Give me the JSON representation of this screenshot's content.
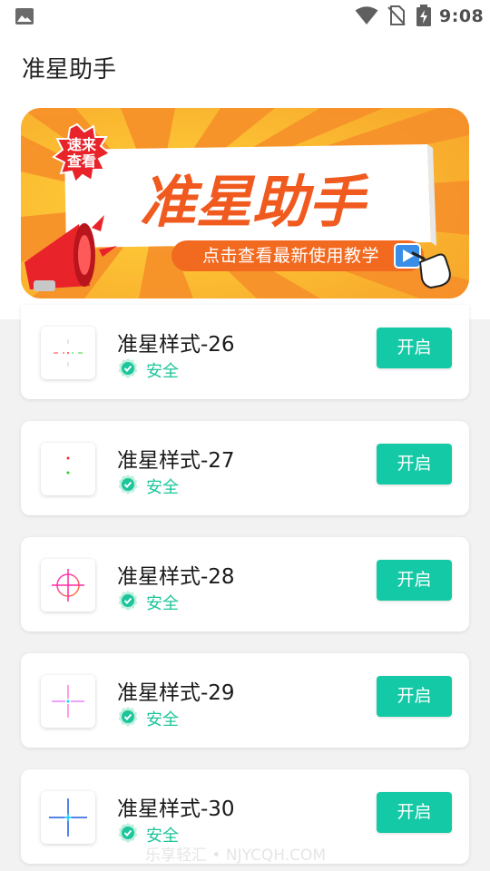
{
  "status_bar": {
    "time": "9:08",
    "icons": [
      "gallery-icon",
      "wifi-icon",
      "no-sim-icon",
      "battery-charging-icon"
    ]
  },
  "app": {
    "title": "准星助手"
  },
  "banner": {
    "badge_line1": "速来",
    "badge_line2": "查看",
    "headline": "准星助手",
    "subtitle": "点击查看最新使用教学",
    "icons": [
      "megaphone-icon",
      "play-icon",
      "pointing-hand-icon"
    ]
  },
  "items": [
    {
      "title": "准星样式-26",
      "status": "安全",
      "button": "开启",
      "icon": "crosshair-dashed-red-green-icon"
    },
    {
      "title": "准星样式-27",
      "status": "安全",
      "button": "开启",
      "icon": "crosshair-dots-red-green-icon"
    },
    {
      "title": "准星样式-28",
      "status": "安全",
      "button": "开启",
      "icon": "crosshair-circle-magenta-icon"
    },
    {
      "title": "准星样式-29",
      "status": "安全",
      "button": "开启",
      "icon": "crosshair-thin-magenta-cyan-icon"
    },
    {
      "title": "准星样式-30",
      "status": "安全",
      "button": "开启",
      "icon": "crosshair-blue-cyan-icon"
    }
  ],
  "watermark": "乐享轻汇 • NJYCQH.COM",
  "colors": {
    "accent": "#14c9a5",
    "safe": "#1cc59b",
    "banner_orange": "#f7902a",
    "banner_text": "#f05a1f"
  }
}
